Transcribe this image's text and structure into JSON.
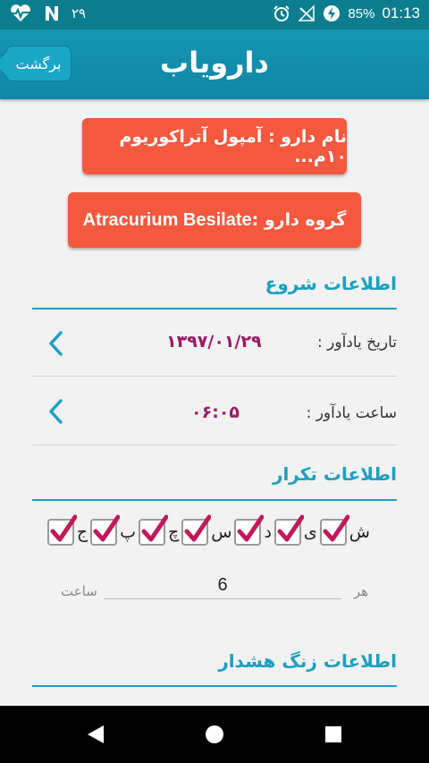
{
  "status_bar": {
    "left_digits": "۲۹",
    "battery": "85%",
    "time": "01:13",
    "icons": [
      "heart-rate-icon",
      "n-icon",
      "alarm-icon",
      "no-signal-icon",
      "battery-charging-icon"
    ]
  },
  "app_bar": {
    "back_label": "برگشت",
    "logo_text": "دارویاب"
  },
  "drug": {
    "name_label": "نام دارو : آمپول آتراکوریوم ۱۰م...",
    "group_prefix": "گروه دارو : ",
    "group_value": "Atracurium Besilate"
  },
  "start_info": {
    "title": "اطلاعات شروع",
    "date_label": "تاریخ یادآور :",
    "date_value": "۱۳۹۷/۰۱/۲۹",
    "time_label": "ساعت یادآور :",
    "time_value": "۰۶:۰۵"
  },
  "repeat_info": {
    "title": "اطلاعات تکرار",
    "days": [
      {
        "label": "ش",
        "checked": true
      },
      {
        "label": "ی",
        "checked": true
      },
      {
        "label": "د",
        "checked": true
      },
      {
        "label": "س",
        "checked": true
      },
      {
        "label": "چ",
        "checked": true
      },
      {
        "label": "پ",
        "checked": true
      },
      {
        "label": "ج",
        "checked": true
      }
    ],
    "every_label": "هر",
    "hours_value": "6",
    "hours_unit": "ساعت"
  },
  "alarm_info": {
    "title": "اطلاعات زنگ هشدار"
  },
  "colors": {
    "accent": "#1c9fc0",
    "orange": "#f4583d",
    "value": "#9c1a6a",
    "check": "#c2185b"
  }
}
